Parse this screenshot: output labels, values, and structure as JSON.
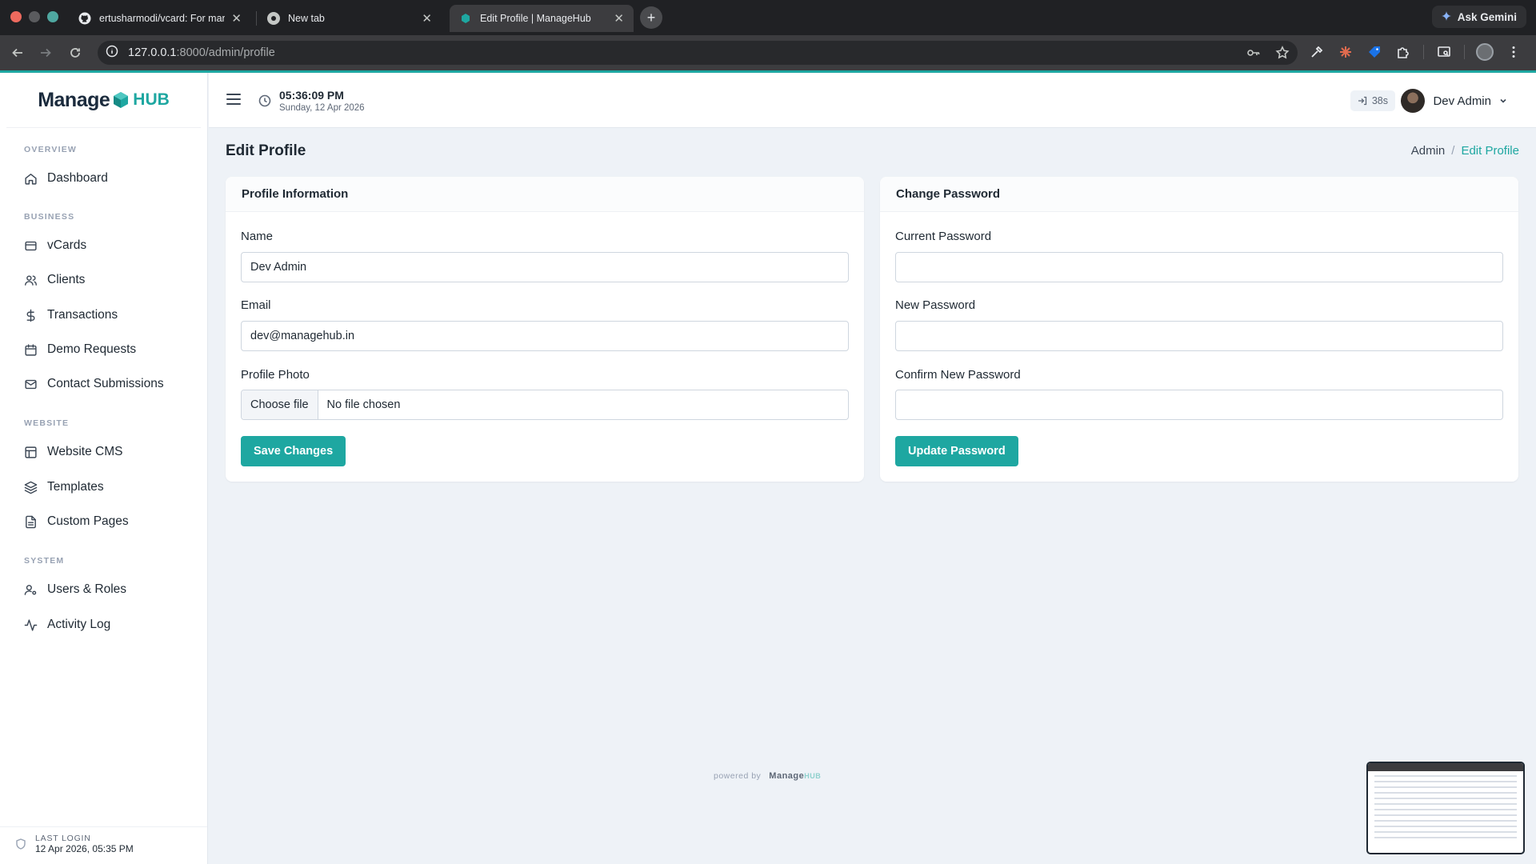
{
  "browser": {
    "tabs": [
      {
        "title": "ertusharmodi/vcard: For man",
        "icon": "github-icon",
        "active": false
      },
      {
        "title": "New tab",
        "icon": "chrome-icon",
        "active": false
      },
      {
        "title": "Edit Profile | ManageHub",
        "icon": "managehub-icon",
        "active": true
      }
    ],
    "new_tab": "+",
    "gemini_label": "Ask Gemini",
    "url_host": "127.0.0.1",
    "url_path": ":8000/admin/profile"
  },
  "brand": {
    "manage": "Manage",
    "hub": "HUB"
  },
  "sidebar": {
    "sections": [
      {
        "title": "OVERVIEW",
        "items": [
          {
            "label": "Dashboard",
            "icon": "home-icon"
          }
        ]
      },
      {
        "title": "BUSINESS",
        "items": [
          {
            "label": "vCards",
            "icon": "card-icon"
          },
          {
            "label": "Clients",
            "icon": "users-icon"
          },
          {
            "label": "Transactions",
            "icon": "dollar-icon"
          },
          {
            "label": "Demo Requests",
            "icon": "calendar-icon"
          },
          {
            "label": "Contact Submissions",
            "icon": "mail-icon"
          }
        ]
      },
      {
        "title": "WEBSITE",
        "items": [
          {
            "label": "Website CMS",
            "icon": "layout-icon"
          },
          {
            "label": "Templates",
            "icon": "layers-icon"
          },
          {
            "label": "Custom Pages",
            "icon": "file-icon"
          }
        ]
      },
      {
        "title": "SYSTEM",
        "items": [
          {
            "label": "Users & Roles",
            "icon": "user-cog-icon"
          },
          {
            "label": "Activity Log",
            "icon": "activity-icon"
          }
        ]
      }
    ],
    "last_login_label": "LAST LOGIN",
    "last_login_value": "12 Apr 2026, 05:35 PM"
  },
  "topbar": {
    "time": "05:36:09 PM",
    "date": "Sunday, 12 Apr 2026",
    "session": "38s",
    "user_name": "Dev Admin"
  },
  "page": {
    "title": "Edit Profile",
    "breadcrumb": [
      "Admin",
      "/",
      "Edit Profile"
    ]
  },
  "profile_card": {
    "header": "Profile Information",
    "name_label": "Name",
    "name_value": "Dev Admin",
    "email_label": "Email",
    "email_value": "dev@managehub.in",
    "photo_label": "Profile Photo",
    "choose_file": "Choose file",
    "no_file": "No file chosen",
    "save_label": "Save Changes"
  },
  "password_card": {
    "header": "Change Password",
    "current_label": "Current Password",
    "new_label": "New Password",
    "confirm_label": "Confirm New Password",
    "update_label": "Update Password"
  },
  "footer": {
    "powered_by": "powered by",
    "brand_manage": "Manage",
    "brand_hub": "HUB"
  },
  "colors": {
    "accent": "#1ea7a1",
    "page_bg": "#eef2f7",
    "chrome_bg": "#202124"
  }
}
